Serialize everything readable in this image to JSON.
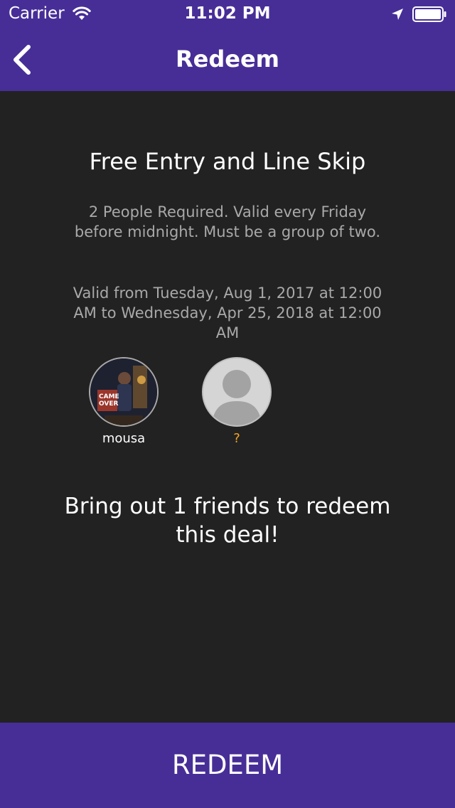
{
  "status_bar": {
    "carrier": "Carrier",
    "time": "11:02 PM"
  },
  "nav": {
    "title": "Redeem",
    "back_icon": "chevron-left-icon"
  },
  "deal": {
    "title": "Free Entry and Line Skip",
    "description": "2 People Required. Valid every Friday before midnight. Must be a group of two.",
    "validity": "Valid from Tuesday, Aug 1, 2017 at 12:00 AM to Wednesday, Apr 25, 2018 at 12:00 AM"
  },
  "group": {
    "members": [
      {
        "name": "mousa",
        "status": "joined"
      },
      {
        "name": "?",
        "status": "pending"
      }
    ]
  },
  "message": "Bring out 1 friends to redeem this deal!",
  "actions": {
    "redeem_label": "REDEEM"
  },
  "colors": {
    "brand": "#472e97",
    "background": "#222222",
    "secondary_text": "#a9a9a9",
    "pending": "#f5a623"
  }
}
